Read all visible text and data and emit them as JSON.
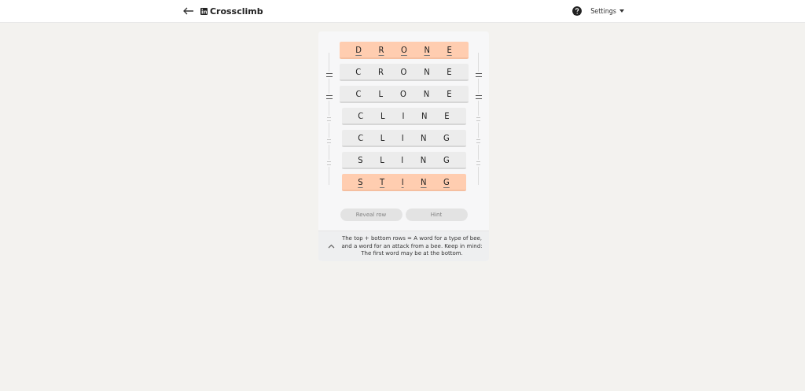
{
  "header": {
    "title": "Crossclimb",
    "settings": "Settings"
  },
  "rows": [
    {
      "kind": "target",
      "letters": [
        "D",
        "R",
        "O",
        "N",
        "E"
      ]
    },
    {
      "kind": "locked",
      "letters": [
        "C",
        "R",
        "O",
        "N",
        "E"
      ]
    },
    {
      "kind": "locked",
      "letters": [
        "C",
        "L",
        "O",
        "N",
        "E"
      ]
    },
    {
      "kind": "open",
      "letters": [
        "C",
        "L",
        "I",
        "N",
        "E"
      ]
    },
    {
      "kind": "open",
      "letters": [
        "C",
        "L",
        "I",
        "N",
        "G"
      ]
    },
    {
      "kind": "open",
      "letters": [
        "S",
        "L",
        "I",
        "N",
        "G"
      ]
    },
    {
      "kind": "target",
      "letters": [
        "S",
        "T",
        "I",
        "N",
        "G"
      ]
    }
  ],
  "buttons": [
    {
      "label": "Reveal row",
      "disabled": true
    },
    {
      "label": "Hint",
      "disabled": true
    }
  ],
  "clue": {
    "expanded": true,
    "text": "The top + bottom rows = A word for a type of bee, and a word for an attack from a bee. Keep in mind: The first word may be at the bottom."
  }
}
